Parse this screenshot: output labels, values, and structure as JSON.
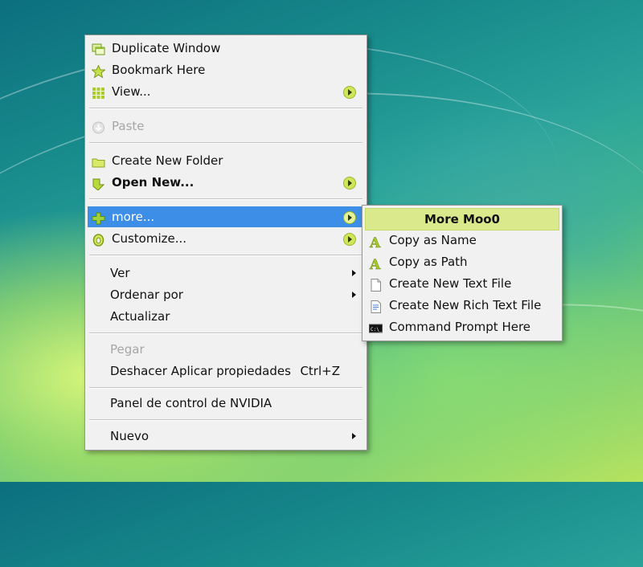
{
  "main_menu": {
    "items": [
      {
        "label": "Duplicate Window",
        "icon": "duplicate-window-icon"
      },
      {
        "label": "Bookmark Here",
        "icon": "star-icon"
      },
      {
        "label": "View...",
        "icon": "grid-view-icon"
      },
      {
        "label": "Paste",
        "icon": "paste-icon"
      },
      {
        "label": "Create New Folder",
        "icon": "folder-icon"
      },
      {
        "label": "Open New...",
        "icon": "open-new-icon"
      },
      {
        "label": "more...",
        "icon": "plus-icon"
      },
      {
        "label": "Customize...",
        "icon": "customize-icon"
      },
      {
        "label": "Ver"
      },
      {
        "label": "Ordenar por"
      },
      {
        "label": "Actualizar"
      },
      {
        "label": "Pegar"
      },
      {
        "label": "Deshacer Aplicar propiedades",
        "shortcut": "Ctrl+Z"
      },
      {
        "label": "Panel de control de NVIDIA"
      },
      {
        "label": "Nuevo"
      }
    ]
  },
  "sub_menu": {
    "header": "More Moo0",
    "items": [
      {
        "label": "Copy as Name",
        "icon": "letter-a-icon"
      },
      {
        "label": "Copy as Path",
        "icon": "letter-a-icon"
      },
      {
        "label": "Create New Text File",
        "icon": "text-file-icon"
      },
      {
        "label": "Create New Rich Text File",
        "icon": "rich-text-file-icon"
      },
      {
        "label": "Command Prompt Here",
        "icon": "command-prompt-icon"
      }
    ]
  },
  "colors": {
    "highlight": "#3d8ee7",
    "menu_background": "#f1f1f1",
    "submenu_header": "#dbe98d",
    "arrow_accent": "#cfe65a"
  }
}
